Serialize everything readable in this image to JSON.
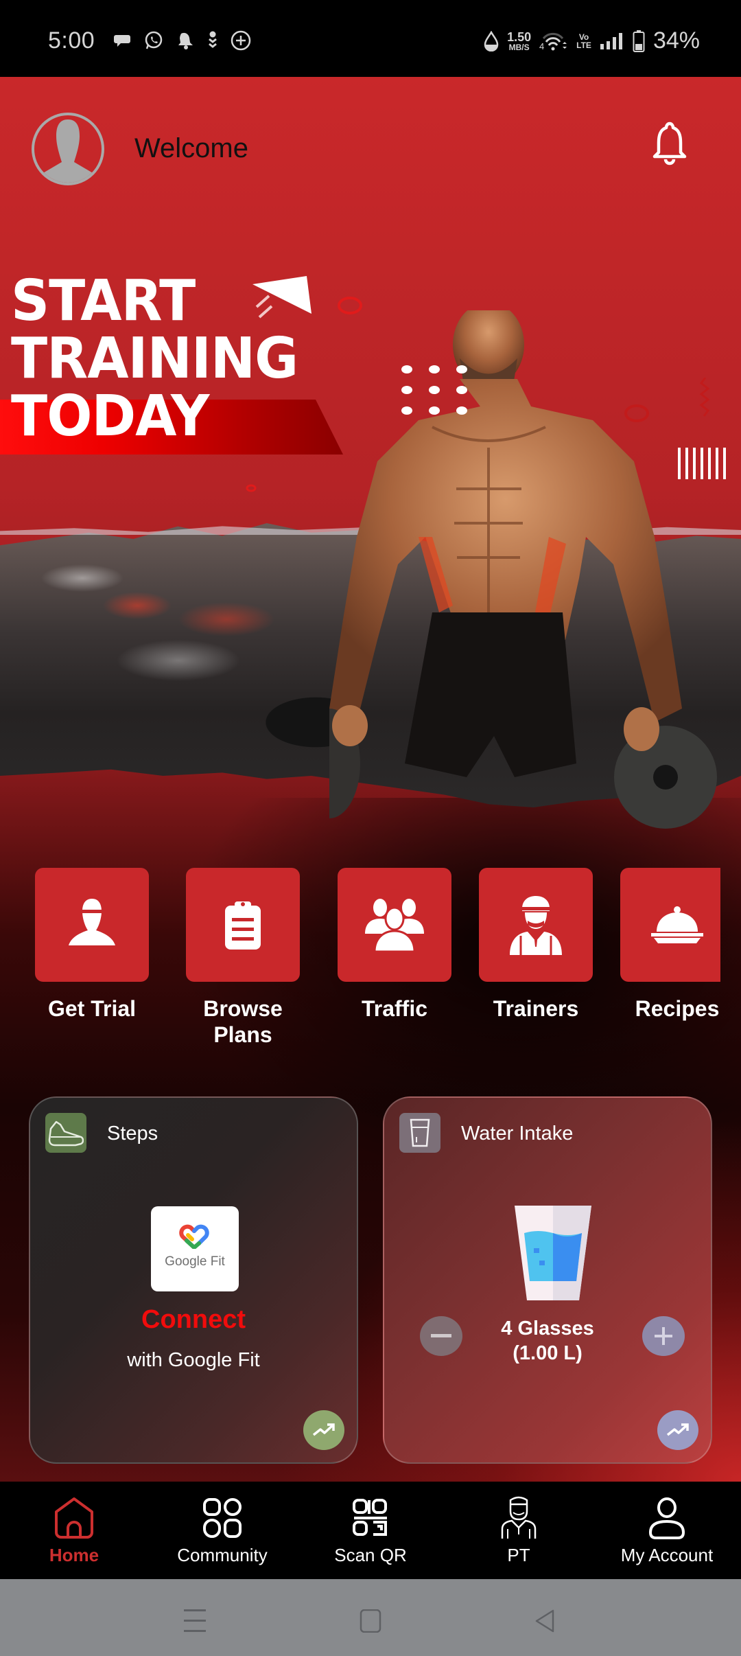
{
  "status_bar": {
    "time": "5:00",
    "notification_icons": [
      "chat-bubble-icon",
      "whatsapp-icon",
      "notification-bell-icon",
      "download-arrows-icon",
      "add-circle-icon"
    ],
    "data_saver_icon": "drop-icon",
    "network_speed_value": "1.50",
    "network_speed_unit": "MB/S",
    "wifi_label": "4",
    "volte_top": "Vo",
    "volte_bottom": "LTE",
    "battery_percent": "34%"
  },
  "header": {
    "welcome_text": "Welcome",
    "avatar_icon": "default-avatar-icon",
    "notification_icon": "bell-icon"
  },
  "banner": {
    "headline_line1": "START",
    "headline_line2": "TRAINING",
    "headline_line3": "TODAY"
  },
  "quick_actions": [
    {
      "label": "Get Trial",
      "icon": "person-icon"
    },
    {
      "label": "Browse Plans",
      "icon": "clipboard-icon"
    },
    {
      "label": "Traffic",
      "icon": "group-icon"
    },
    {
      "label": "Trainers",
      "icon": "trainer-icon"
    },
    {
      "label": "Recipes",
      "icon": "cloche-icon"
    }
  ],
  "steps_card": {
    "title": "Steps",
    "logo_text": "Google Fit",
    "connect_label": "Connect",
    "connect_sub": "with Google Fit",
    "accent_color": "#8fa86e"
  },
  "water_card": {
    "title": "Water Intake",
    "glasses_label": "4 Glasses",
    "liters_label": "(1.00 L)",
    "glasses_count": 4,
    "liters": 1.0,
    "accent_color": "#9a9cc4"
  },
  "bottom_nav": [
    {
      "label": "Home",
      "icon": "home-icon",
      "active": true
    },
    {
      "label": "Community",
      "icon": "community-grid-icon",
      "active": false
    },
    {
      "label": "Scan QR",
      "icon": "qr-code-icon",
      "active": false
    },
    {
      "label": "PT",
      "icon": "personal-trainer-icon",
      "active": false
    },
    {
      "label": "My Account",
      "icon": "account-icon",
      "active": false
    }
  ],
  "colors": {
    "brand_red": "#c9282b",
    "active_nav": "#cc2f2f",
    "connect_red": "#f10c0c"
  }
}
